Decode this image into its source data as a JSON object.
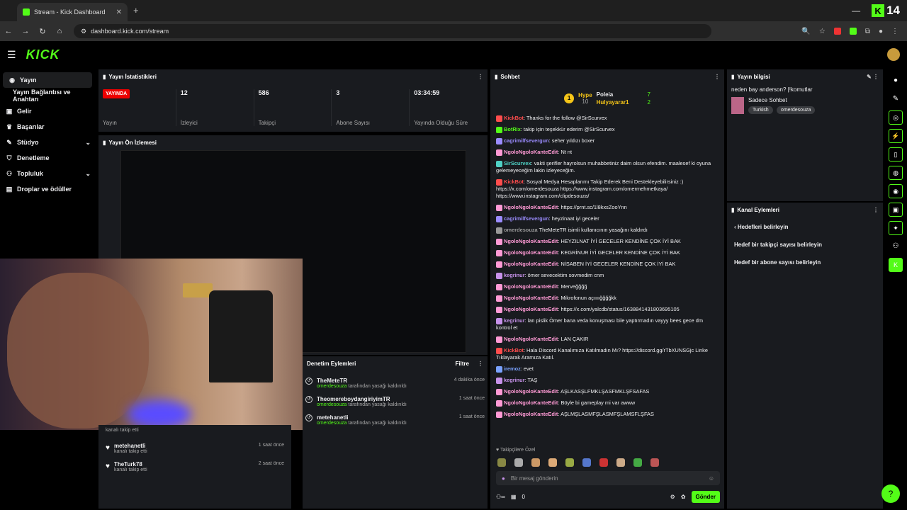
{
  "browser": {
    "tab_title": "Stream - Kick Dashboard",
    "new_tab": "+",
    "url": "dashboard.kick.com/stream",
    "live_count": "14",
    "colors": {
      "accent": "#53fc18"
    }
  },
  "header": {
    "logo": "KICK"
  },
  "sidebar": {
    "items": [
      {
        "label": "Yayın",
        "icon": "broadcast-icon"
      },
      {
        "label": "Yayın Bağlantısı ve Anahtarı"
      },
      {
        "label": "Gelir",
        "icon": "money-icon"
      },
      {
        "label": "Başarılar",
        "icon": "trophy-icon"
      },
      {
        "label": "Stüdyo",
        "icon": "studio-icon"
      },
      {
        "label": "Denetleme",
        "icon": "shield-icon"
      },
      {
        "label": "Topluluk",
        "icon": "people-icon"
      },
      {
        "label": "Droplar ve ödüller",
        "icon": "gift-icon"
      }
    ]
  },
  "stats": {
    "title": "Yayın İstatistikleri",
    "live_badge": "YAYINDA",
    "status_label": "Yayın",
    "viewers": "12",
    "viewers_label": "İzleyici",
    "followers": "586",
    "followers_label": "Takipçi",
    "subs": "3",
    "subs_label": "Abone Sayısı",
    "uptime": "03:34:59",
    "uptime_label": "Yayında Olduğu Süre"
  },
  "preview": {
    "title": "Yayın Ön İzlemesi"
  },
  "followers": [
    {
      "name": "",
      "status": "kanalı takip etti",
      "time": ""
    },
    {
      "name": "metehanetli",
      "status": "kanalı takip etti",
      "time": "1 saat önce"
    },
    {
      "name": "TheTurk78",
      "status": "kanalı takip etti",
      "time": "2 saat önce"
    }
  ],
  "moderation": {
    "title": "Denetim Eylemleri",
    "filter": "Filtre",
    "rows": [
      {
        "name": "TheMeteTR",
        "by": "omerdesouza",
        "action": "tarafından yasağı kaldırıldı",
        "time": "4 dakika önce"
      },
      {
        "name": "TheomereboydangiriyimTR",
        "by": "omerdesouza",
        "action": "tarafından yasağı kaldırıldı",
        "time": "1 saat önce"
      },
      {
        "name": "metehanetli",
        "by": "omerdesouza",
        "action": "tarafından yasağı kaldırıldı",
        "time": "1 saat önce"
      }
    ]
  },
  "chat": {
    "title": "Sohbet",
    "hype": {
      "label": "Hype",
      "score": "10",
      "user1": "Poleia",
      "user1_count": "7",
      "user2": "Hulyayarar1",
      "user2_count": "2"
    },
    "messages": [
      {
        "user": "KickBot",
        "text": ": Thanks for the follow @SirScurvex",
        "color": "#ff4d4d"
      },
      {
        "user": "BotRix",
        "text": ": takip için teşekkür ederim @SirScurvex",
        "color": "#53fc18"
      },
      {
        "user": "cagrimilfsevergun",
        "text": ": seher yıldızı boxer",
        "color": "#9b8cff"
      },
      {
        "user": "NgoloNgoloKanteEdit",
        "text": ": Nt nt",
        "color": "#ff9ad5"
      },
      {
        "user": "SirScurvex",
        "text": ": vakti şerifler hayrolsun muhabbetiniz daim olsun efendim. maalesef ki oyuna gelemeyeceğim lakin izleyeceğim.",
        "color": "#4fd1c5"
      },
      {
        "user": "KickBot",
        "text": ": Sosyal Medya Hesaplarımı Takip Ederek Beni Destekleyebilirsiniz :) https://x.com/omerdesouza https://www.instagram.com/omermehmetkaya/ https://www.instagram.com/clipdesouza/",
        "color": "#ff4d4d"
      },
      {
        "user": "NgoloNgoloKanteEdit",
        "text": ": https://prnt.sc/1l8kxsZooYnn",
        "color": "#ff9ad5"
      },
      {
        "user": "cagrimilfsevergun",
        "text": ": heyzinaat iyi geceler",
        "color": "#9b8cff"
      },
      {
        "user": "omerdesouza",
        "text": " TheMeteTR isimli kullanıcının yasağını kaldırdı",
        "color": "#999999"
      },
      {
        "user": "NgoloNgoloKanteEdit",
        "text": ": HEYZILNAT İYİ GECELER KENDİNE ÇOK İYİ BAK",
        "color": "#ff9ad5"
      },
      {
        "user": "NgoloNgoloKanteEdit",
        "text": ": KEGRİNUR İYİ GECELER KENDİNE ÇOK İYİ BAK",
        "color": "#ff9ad5"
      },
      {
        "user": "NgoloNgoloKanteEdit",
        "text": ": NİSABEN İYİ GECELER KENDİNE ÇOK İYİ BAK",
        "color": "#ff9ad5"
      },
      {
        "user": "kegrinur",
        "text": ": ömer sevecektim sovmedim cnm",
        "color": "#c792ea"
      },
      {
        "user": "NgoloNgoloKanteEdit",
        "text": ": Merveğğğğ",
        "color": "#ff9ad5"
      },
      {
        "user": "NgoloNgoloKanteEdit",
        "text": ": Mikrofonun açıııığğğğkk",
        "color": "#ff9ad5"
      },
      {
        "user": "NgoloNgoloKanteEdit",
        "text": ": https://x.com/yalcdb/status/1638841431803695105",
        "color": "#ff9ad5"
      },
      {
        "user": "kegrinur",
        "text": ": lan pislik Ömer bana veda konuşması bile yaptırmadın vayyy bees gece dm kontrol et",
        "color": "#c792ea"
      },
      {
        "user": "NgoloNgoloKanteEdit",
        "text": ": LAN ÇAKIR",
        "color": "#ff9ad5"
      },
      {
        "user": "KickBot",
        "text": ": Hala Discord Kanalımıza Katılmadın Mı? https://discord.gg/rTbXUNSGjc Linke Tıklayarak Aramıza Katıl.",
        "color": "#ff4d4d"
      },
      {
        "user": "iremoz",
        "text": ": evet",
        "color": "#7aa2ff"
      },
      {
        "user": "kegrinur",
        "text": ": TAŞ",
        "color": "#c792ea"
      },
      {
        "user": "NgoloNgoloKanteEdit",
        "text": ": AŞLKASŞLFMKLŞASFMKLŞFSAFAS",
        "color": "#ff9ad5"
      },
      {
        "user": "NgoloNgoloKanteEdit",
        "text": ": Böyle bi gameplay mi var awww",
        "color": "#ff9ad5"
      },
      {
        "user": "NgoloNgoloKanteEdit",
        "text": ": AŞLMŞLASMFŞLASMFŞLAMSFLŞFAS",
        "color": "#ff9ad5"
      }
    ],
    "followers_only": "Takipçilere Özel",
    "input_placeholder": "Bir mesaj gönderin",
    "viewer_count": "0",
    "send": "Gönder"
  },
  "stream_info": {
    "title": "Yayın bilgisi",
    "stream_title": "neden bay anderson? |!komutlar",
    "category": "Sadece Sohbet",
    "tags": [
      "Turkish",
      "omerdesouza"
    ]
  },
  "channel_actions": {
    "title": "Kanal Eylemleri",
    "back_label": "Hedefleri belirleyin",
    "links": [
      "Hedef bir takipçi sayısı belirleyin",
      "Hedef bir abone sayısı belirleyin"
    ]
  }
}
